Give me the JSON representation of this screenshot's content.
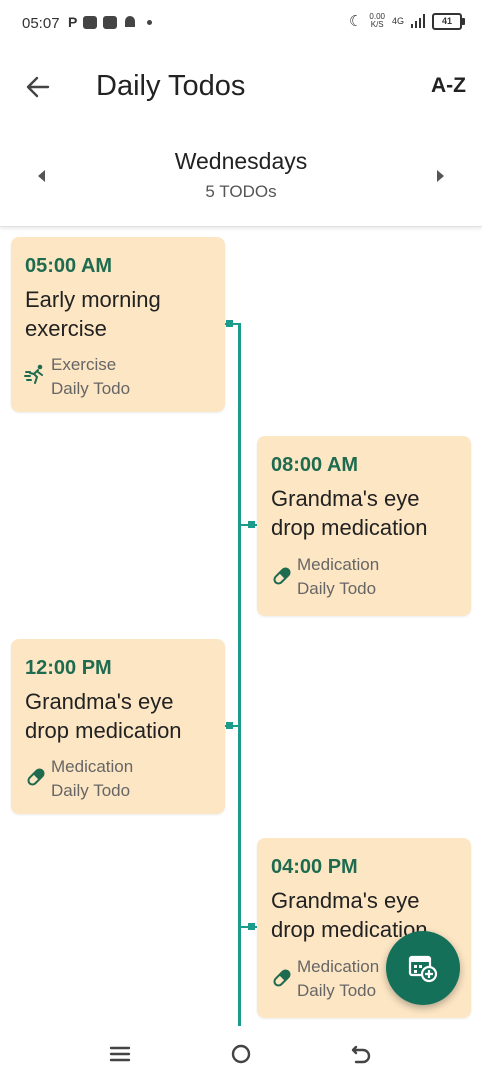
{
  "status_bar": {
    "time": "05:07",
    "left_icons": [
      "P",
      "notification-icon",
      "notification-icon",
      "android-icon"
    ],
    "net_speed_top": "0.00",
    "net_speed_bottom": "K/S",
    "network": "4G",
    "battery": "41"
  },
  "app_bar": {
    "title": "Daily Todos",
    "sort_label": "A-Z"
  },
  "day_nav": {
    "day": "Wednesdays",
    "count": "5 TODOs"
  },
  "todos": [
    {
      "time": "05:00 AM",
      "title": "Early morning exercise",
      "category": "Exercise",
      "type": "Daily Todo",
      "icon": "running-icon"
    },
    {
      "time": "08:00 AM",
      "title": "Grandma's eye drop medication",
      "category": "Medication",
      "type": "Daily Todo",
      "icon": "pill-icon"
    },
    {
      "time": "12:00 PM",
      "title": "Grandma's eye drop medication",
      "category": "Medication",
      "type": "Daily Todo",
      "icon": "pill-icon"
    },
    {
      "time": "04:00 PM",
      "title": "Grandma's eye drop medication",
      "category": "Medication",
      "type": "Daily Todo",
      "icon": "pill-icon"
    }
  ],
  "colors": {
    "accent": "#1a9b8c",
    "card_bg": "#fde6c4",
    "time_text": "#1e6b4f",
    "fab": "#15705a"
  }
}
